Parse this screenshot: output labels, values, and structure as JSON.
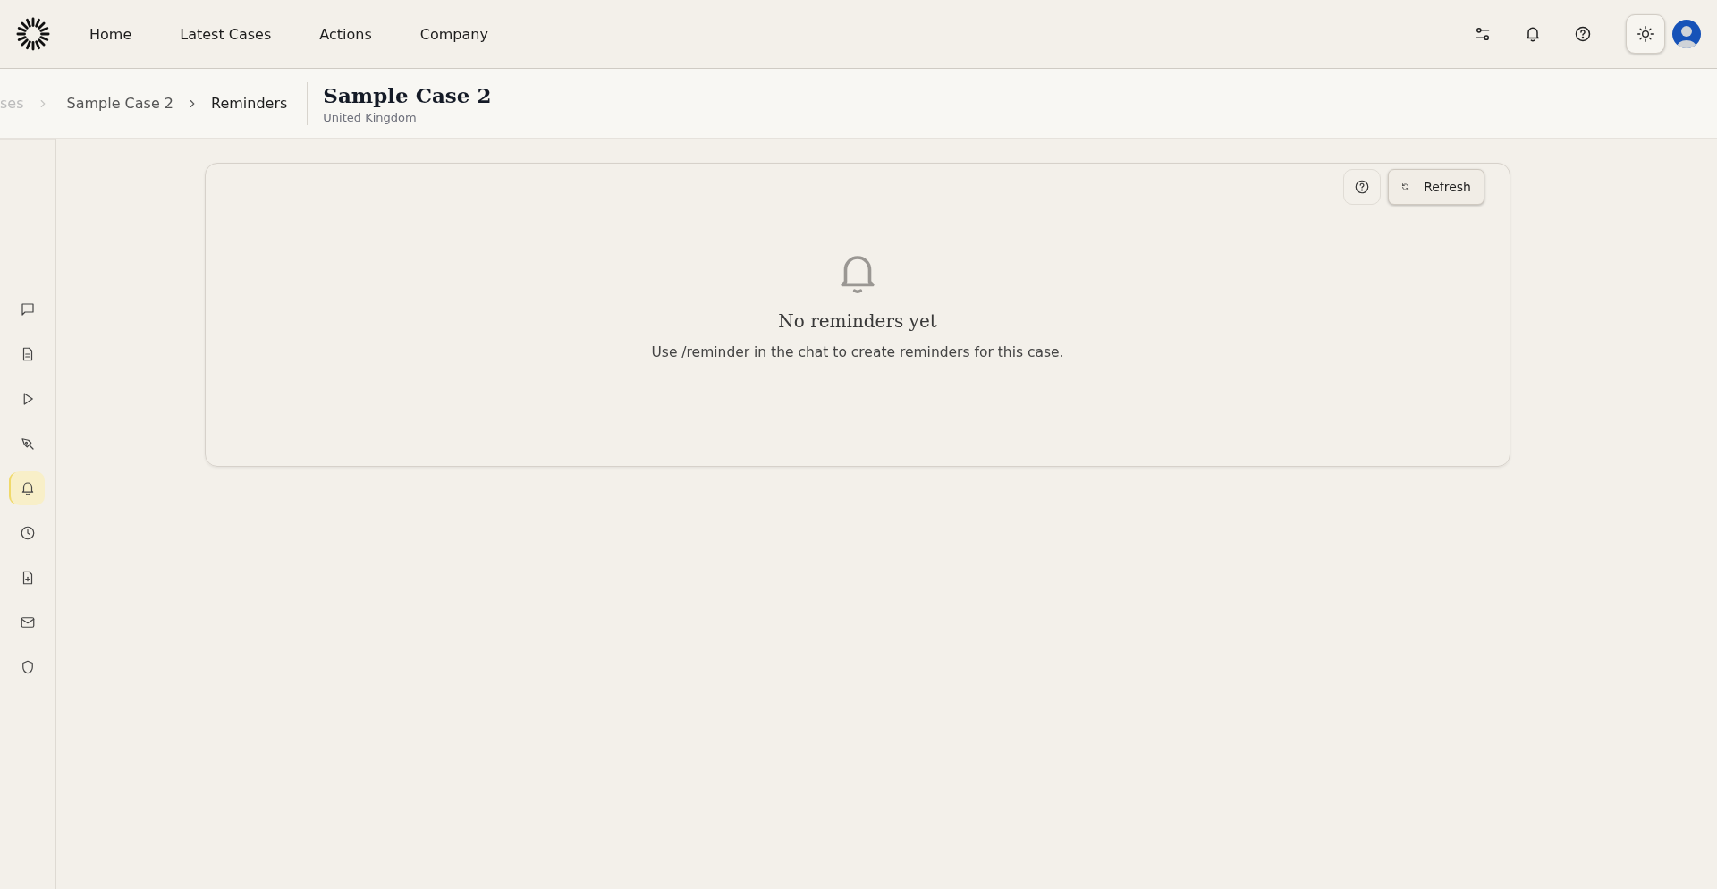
{
  "nav": {
    "items": [
      "Home",
      "Latest Cases",
      "Actions",
      "Company"
    ]
  },
  "header_actions": {
    "theme_toggle": {
      "selected": true
    }
  },
  "breadcrumb": [
    "ses",
    "Sample Case 2",
    "Reminders"
  ],
  "case": {
    "title": "Sample Case 2",
    "subtitle": "United Kingdom"
  },
  "sidebar": {
    "items": [
      {
        "kind": "chat",
        "selected": false
      },
      {
        "kind": "document",
        "selected": false
      },
      {
        "kind": "play",
        "selected": false
      },
      {
        "kind": "pen",
        "selected": false
      },
      {
        "kind": "bell",
        "selected": true
      },
      {
        "kind": "clock",
        "selected": false
      },
      {
        "kind": "file-plus",
        "selected": false
      },
      {
        "kind": "mail",
        "selected": false
      },
      {
        "kind": "shield",
        "selected": false
      }
    ]
  },
  "panel": {
    "refresh_label": "Refresh",
    "empty_title": "No reminders yet",
    "empty_text": "Use /reminder in the chat to create reminders for this case."
  }
}
